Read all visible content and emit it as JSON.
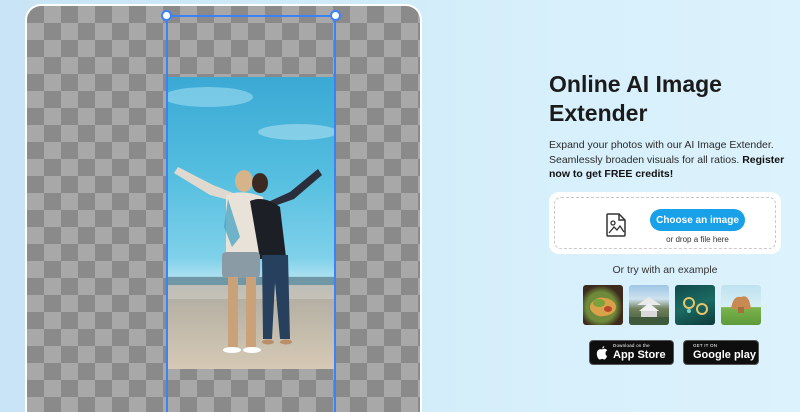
{
  "hero": {
    "title": "Online AI Image Extender",
    "description": "Expand your photos with our AI Image Extender. Seamlessly broaden visuals for all ratios.",
    "register_cta": "Register now to get FREE credits!"
  },
  "upload": {
    "button_label": "Choose an image",
    "drop_hint": "or drop a file here",
    "icon": "image-file-icon"
  },
  "examples": {
    "label": "Or try with an example",
    "items": [
      "food-example-thumbnail",
      "temple-example-thumbnail",
      "jewelry-example-thumbnail",
      "rock-landscape-example-thumbnail"
    ]
  },
  "stores": {
    "apple": {
      "small": "Download on the",
      "big": "App Store",
      "icon": "apple-icon"
    },
    "google": {
      "small": "GET IT ON",
      "big": "Google play",
      "icon": "google-play-icon"
    }
  },
  "colors": {
    "accent": "#18a0e8",
    "crop_frame": "#3b82f6"
  }
}
